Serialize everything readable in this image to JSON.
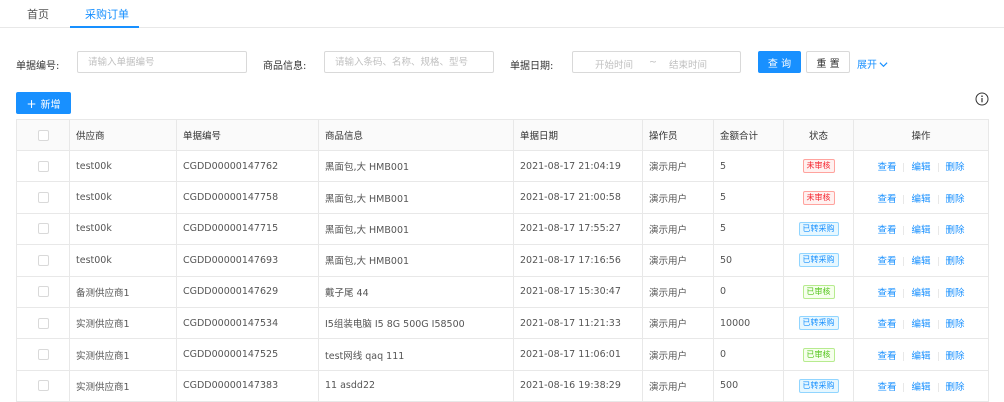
{
  "tabs": [
    {
      "label": "首页"
    },
    {
      "label": "采购订单",
      "active": true
    }
  ],
  "search": {
    "bill_no_label": "单据编号:",
    "bill_no_placeholder": "请输入单据编号",
    "goods_label": "商品信息:",
    "goods_placeholder": "请输入条码、名称、规格、型号",
    "date_label": "单据日期:",
    "date_start_placeholder": "开始时间",
    "date_sep": "~",
    "date_end_placeholder": "结束时间",
    "query_label": "查 询",
    "reset_label": "重 置",
    "expand_label": "展开"
  },
  "toolbar": {
    "new_label": "新增",
    "info_icon": "info-circle-icon"
  },
  "colors": {
    "primary": "#1890ff",
    "red": "#f5222d",
    "green": "#52c41a"
  },
  "table": {
    "headers": [
      "供应商",
      "单据编号",
      "商品信息",
      "单据日期",
      "操作员",
      "金额合计",
      "状态",
      "操作"
    ],
    "actions": [
      "查看",
      "编辑",
      "删除"
    ],
    "rows": [
      {
        "supplier": "test00k",
        "bill_no": "CGDD00000147762",
        "goods": "黑面包,大 HMB001",
        "date": "2021-08-17 21:04:19",
        "operator": "演示用户",
        "amount": "5",
        "status": "未审核",
        "status_color": "red"
      },
      {
        "supplier": "test00k",
        "bill_no": "CGDD00000147758",
        "goods": "黑面包,大 HMB001",
        "date": "2021-08-17 21:00:58",
        "operator": "演示用户",
        "amount": "5",
        "status": "未审核",
        "status_color": "red"
      },
      {
        "supplier": "test00k",
        "bill_no": "CGDD00000147715",
        "goods": "黑面包,大 HMB001",
        "date": "2021-08-17 17:55:27",
        "operator": "演示用户",
        "amount": "5",
        "status": "已转采购",
        "status_color": "blue"
      },
      {
        "supplier": "test00k",
        "bill_no": "CGDD00000147693",
        "goods": "黑面包,大 HMB001",
        "date": "2021-08-17 17:16:56",
        "operator": "演示用户",
        "amount": "50",
        "status": "已转采购",
        "status_color": "blue"
      },
      {
        "supplier": "备测供应商1",
        "bill_no": "CGDD00000147629",
        "goods": "戴子尾 44",
        "date": "2021-08-17 15:30:47",
        "operator": "演示用户",
        "amount": "0",
        "status": "已审核",
        "status_color": "green"
      },
      {
        "supplier": "实测供应商1",
        "bill_no": "CGDD00000147534",
        "goods": "I5组装电脑 I5 8G 500G I58500",
        "date": "2021-08-17 11:21:33",
        "operator": "演示用户",
        "amount": "10000",
        "status": "已转采购",
        "status_color": "blue"
      },
      {
        "supplier": "实测供应商1",
        "bill_no": "CGDD00000147525",
        "goods": "test网线 qaq 111",
        "date": "2021-08-17 11:06:01",
        "operator": "演示用户",
        "amount": "0",
        "status": "已审核",
        "status_color": "green"
      },
      {
        "supplier": "实测供应商1",
        "bill_no": "CGDD00000147383",
        "goods": "11 asdd22",
        "date": "2021-08-16 19:38:29",
        "operator": "演示用户",
        "amount": "500",
        "status": "已转采购",
        "status_color": "blue"
      }
    ]
  }
}
